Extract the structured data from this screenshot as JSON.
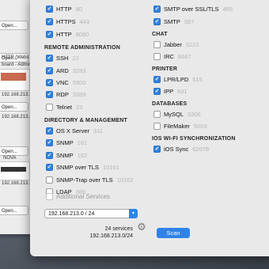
{
  "background_window": {
    "rows": [
      {
        "open_label": "Open...",
        "title": ""
      },
      {
        "open_label": "Open...",
        "title": "HTTP (Webs"
      },
      {
        "open_label": "",
        "title": "board - Admin To"
      },
      {
        "open_label": "",
        "title": "192.168.213.1"
      },
      {
        "open_label": "Open...",
        "title": "HTTP (Webs"
      },
      {
        "open_label": "",
        "title": "192.168.213.1"
      },
      {
        "open_label": "Open...",
        "title": "HTTP (Webs"
      },
      {
        "open_label": "",
        "title": "NOVA"
      },
      {
        "open_label": "",
        "title": "192.168.213.1"
      },
      {
        "open_label": "Open...",
        "title": ""
      }
    ]
  },
  "left_column": {
    "top_items": [
      {
        "label": "HTTP",
        "port": "80",
        "checked": true
      },
      {
        "label": "HTTPS",
        "port": "443",
        "checked": true
      },
      {
        "label": "HTTP",
        "port": "8080",
        "checked": true
      }
    ],
    "remote_title": "REMOTE ADMINISTRATION",
    "remote_items": [
      {
        "label": "SSH",
        "port": "22",
        "checked": true
      },
      {
        "label": "ARD",
        "port": "3283",
        "checked": true
      },
      {
        "label": "VNC",
        "port": "5900",
        "checked": true
      },
      {
        "label": "RDP",
        "port": "3389",
        "checked": true
      },
      {
        "label": "Telnet",
        "port": "23",
        "checked": false
      }
    ],
    "directory_title": "DIRECTORY & MANAGEMENT",
    "directory_items": [
      {
        "label": "OS X Server",
        "port": "311",
        "checked": true
      },
      {
        "label": "SNMP",
        "port": "161",
        "checked": true
      },
      {
        "label": "SNMP",
        "port": "162",
        "checked": true
      },
      {
        "label": "SNMP over TLS",
        "port": "10161",
        "checked": true
      },
      {
        "label": "SNMP-Trap over TLS",
        "port": "10162",
        "checked": false
      },
      {
        "label": "LDAP",
        "port": "389",
        "checked": false
      }
    ]
  },
  "right_column": {
    "top_items": [
      {
        "label": "SMTP over SSL/TLS",
        "port": "465",
        "checked": true
      },
      {
        "label": "SMTP",
        "port": "587",
        "checked": true
      }
    ],
    "chat_title": "CHAT",
    "chat_items": [
      {
        "label": "Jabber",
        "port": "5222",
        "checked": false
      },
      {
        "label": "IRC",
        "port": "6667",
        "checked": false
      }
    ],
    "printer_title": "PRINTER",
    "printer_items": [
      {
        "label": "LPR/LPD",
        "port": "515",
        "checked": true
      },
      {
        "label": "IPP",
        "port": "631",
        "checked": true
      }
    ],
    "databases_title": "DATABASES",
    "databases_items": [
      {
        "label": "MySQL",
        "port": "3306",
        "checked": false
      },
      {
        "label": "FileMaker",
        "port": "5003",
        "checked": false
      }
    ],
    "ios_title": "IOS WI-FI SYNCHRONIZATION",
    "ios_items": [
      {
        "label": "iOS Sync",
        "port": "62078",
        "checked": true
      }
    ]
  },
  "additional_services_label": "Additional Services",
  "network_select_value": "192.168.213.0  /  24",
  "status": {
    "services_count": "24 services",
    "network": "192.168.213.0/24"
  },
  "scan_label": "Scan",
  "icons": {
    "gear": "gear-icon",
    "dropdown": "chevron-down-icon",
    "checkbox": "checkmark-icon"
  },
  "colors": {
    "accent": "#2f83e6",
    "port_text": "#b4b4b4",
    "panel_bg": "#e9e9e9"
  }
}
